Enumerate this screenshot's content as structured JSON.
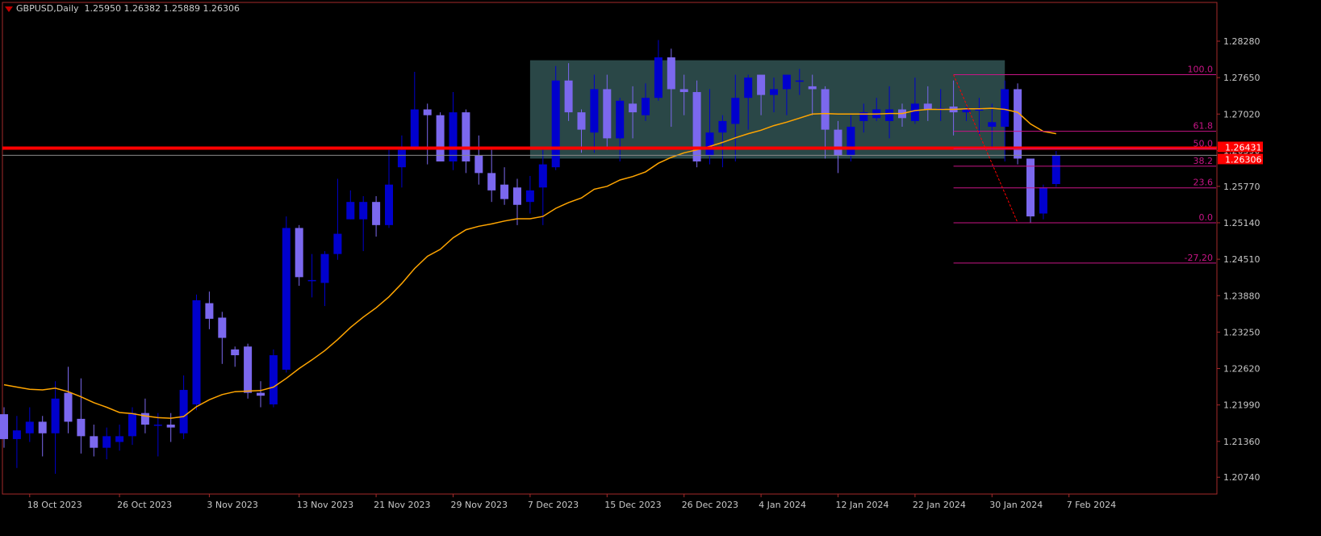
{
  "header": {
    "symbol": "GBPUSD,Daily",
    "ohlc": "1.25950 1.26382 1.25889 1.26306"
  },
  "colors": {
    "background": "#000000",
    "axis": "#a52a2a",
    "axis_text": "#c8c8c8",
    "bull": "#0000cd",
    "bear": "#7b68ee",
    "ma": "#ffa500",
    "resistance": "#ff0000",
    "rectangle": "#2f4f4f",
    "fibo": "#c71585"
  },
  "chart_data": {
    "type": "candlestick",
    "y_range": [
      1.2045,
      1.2895
    ],
    "y_ticks": [
      "1.28280",
      "1.27650",
      "1.27020",
      "1.26390",
      "1.25770",
      "1.25140",
      "1.24510",
      "1.23880",
      "1.23250",
      "1.22620",
      "1.21990",
      "1.21360",
      "1.20740"
    ],
    "x_labels": [
      {
        "i": 2,
        "text": "18 Oct 2023"
      },
      {
        "i": 9,
        "text": "26 Oct 2023"
      },
      {
        "i": 16,
        "text": "3 Nov 2023"
      },
      {
        "i": 23,
        "text": "13 Nov 2023"
      },
      {
        "i": 29,
        "text": "21 Nov 2023"
      },
      {
        "i": 35,
        "text": "29 Nov 2023"
      },
      {
        "i": 41,
        "text": "7 Dec 2023"
      },
      {
        "i": 47,
        "text": "15 Dec 2023"
      },
      {
        "i": 53,
        "text": "26 Dec 2023"
      },
      {
        "i": 59,
        "text": "4 Jan 2024"
      },
      {
        "i": 65,
        "text": "12 Jan 2024"
      },
      {
        "i": 71,
        "text": "22 Jan 2024"
      },
      {
        "i": 77,
        "text": "30 Jan 2024"
      },
      {
        "i": 83,
        "text": "7 Feb 2024"
      }
    ],
    "candles": [
      [
        1.2183,
        1.214,
        1.2195,
        1.2125
      ],
      [
        1.214,
        1.2155,
        1.218,
        1.209
      ],
      [
        1.215,
        1.217,
        1.2195,
        1.2135
      ],
      [
        1.217,
        1.215,
        1.218,
        1.211
      ],
      [
        1.215,
        1.221,
        1.224,
        1.208
      ],
      [
        1.222,
        1.217,
        1.2265,
        1.215
      ],
      [
        1.2175,
        1.2145,
        1.2245,
        1.2115
      ],
      [
        1.2145,
        1.2125,
        1.2165,
        1.211
      ],
      [
        1.2125,
        1.2145,
        1.216,
        1.2105
      ],
      [
        1.2135,
        1.2145,
        1.2165,
        1.212
      ],
      [
        1.2145,
        1.2185,
        1.2195,
        1.213
      ],
      [
        1.2185,
        1.2165,
        1.221,
        1.215
      ],
      [
        1.2165,
        1.2165,
        1.2185,
        1.211
      ],
      [
        1.2165,
        1.216,
        1.2185,
        1.2135
      ],
      [
        1.215,
        1.2225,
        1.225,
        1.214
      ],
      [
        1.22,
        1.238,
        1.239,
        1.219
      ],
      [
        1.2375,
        1.2348,
        1.2395,
        1.233
      ],
      [
        1.235,
        1.2315,
        1.236,
        1.227
      ],
      [
        1.2295,
        1.2285,
        1.23,
        1.2265
      ],
      [
        1.23,
        1.222,
        1.2305,
        1.221
      ],
      [
        1.222,
        1.2215,
        1.224,
        1.2195
      ],
      [
        1.22,
        1.2285,
        1.2295,
        1.2195
      ],
      [
        1.226,
        1.2505,
        1.2525,
        1.2255
      ],
      [
        1.2505,
        1.242,
        1.251,
        1.2405
      ],
      [
        1.2415,
        1.2415,
        1.246,
        1.2385
      ],
      [
        1.241,
        1.246,
        1.2465,
        1.237
      ],
      [
        1.246,
        1.2495,
        1.259,
        1.245
      ],
      [
        1.252,
        1.255,
        1.257,
        1.252
      ],
      [
        1.252,
        1.255,
        1.256,
        1.2465
      ],
      [
        1.255,
        1.251,
        1.256,
        1.249
      ],
      [
        1.251,
        1.258,
        1.264,
        1.2505
      ],
      [
        1.261,
        1.264,
        1.2665,
        1.2575
      ],
      [
        1.2645,
        1.271,
        1.2775,
        1.264
      ],
      [
        1.271,
        1.27,
        1.272,
        1.2615
      ],
      [
        1.27,
        1.262,
        1.2705,
        1.262
      ],
      [
        1.262,
        1.2705,
        1.274,
        1.2605
      ],
      [
        1.2705,
        1.262,
        1.271,
        1.26
      ],
      [
        1.263,
        1.26,
        1.2665,
        1.258
      ],
      [
        1.26,
        1.257,
        1.264,
        1.255
      ],
      [
        1.258,
        1.2555,
        1.261,
        1.2545
      ],
      [
        1.2575,
        1.2545,
        1.259,
        1.251
      ],
      [
        1.255,
        1.257,
        1.2595,
        1.253
      ],
      [
        1.2575,
        1.2615,
        1.264,
        1.251
      ],
      [
        1.261,
        1.276,
        1.2785,
        1.2605
      ],
      [
        1.276,
        1.2705,
        1.279,
        1.269
      ],
      [
        1.2705,
        1.2675,
        1.271,
        1.2635
      ],
      [
        1.267,
        1.2745,
        1.277,
        1.2635
      ],
      [
        1.2745,
        1.266,
        1.277,
        1.264
      ],
      [
        1.266,
        1.2725,
        1.273,
        1.262
      ],
      [
        1.272,
        1.2705,
        1.275,
        1.266
      ],
      [
        1.27,
        1.273,
        1.2755,
        1.269
      ],
      [
        1.273,
        1.28,
        1.283,
        1.2725
      ],
      [
        1.28,
        1.2745,
        1.2815,
        1.268
      ],
      [
        1.2745,
        1.274,
        1.277,
        1.27
      ],
      [
        1.274,
        1.262,
        1.276,
        1.261
      ],
      [
        1.263,
        1.267,
        1.2745,
        1.2615
      ],
      [
        1.267,
        1.269,
        1.27,
        1.261
      ],
      [
        1.2685,
        1.273,
        1.277,
        1.262
      ],
      [
        1.273,
        1.2765,
        1.277,
        1.2675
      ],
      [
        1.277,
        1.2735,
        1.277,
        1.27
      ],
      [
        1.2735,
        1.2745,
        1.2765,
        1.2705
      ],
      [
        1.2745,
        1.277,
        1.277,
        1.27
      ],
      [
        1.276,
        1.276,
        1.278,
        1.2735
      ],
      [
        1.275,
        1.2745,
        1.277,
        1.27
      ],
      [
        1.2745,
        1.2675,
        1.275,
        1.2625
      ],
      [
        1.2675,
        1.263,
        1.269,
        1.26
      ],
      [
        1.263,
        1.268,
        1.27,
        1.262
      ],
      [
        1.269,
        1.2705,
        1.272,
        1.267
      ],
      [
        1.2695,
        1.271,
        1.273,
        1.269
      ],
      [
        1.269,
        1.271,
        1.275,
        1.266
      ],
      [
        1.271,
        1.2695,
        1.272,
        1.268
      ],
      [
        1.269,
        1.272,
        1.2765,
        1.2685
      ],
      [
        1.272,
        1.271,
        1.275,
        1.269
      ],
      [
        1.271,
        1.2712,
        1.2745,
        1.269
      ],
      [
        1.2715,
        1.2705,
        1.276,
        1.2665
      ],
      [
        1.2705,
        1.271,
        1.2715,
        1.269
      ],
      [
        1.271,
        1.271,
        1.273,
        1.2665
      ],
      [
        1.268,
        1.2688,
        1.272,
        1.2645
      ],
      [
        1.268,
        1.2745,
        1.276,
        1.262
      ],
      [
        1.2745,
        1.2625,
        1.2755,
        1.2615
      ],
      [
        1.2625,
        1.2525,
        1.2625,
        1.2514
      ],
      [
        1.253,
        1.2575,
        1.258,
        1.252
      ],
      [
        1.2581,
        1.2631,
        1.2638,
        1.2576
      ]
    ],
    "ma_period": 20,
    "ma_values": [
      1.2234,
      1.223,
      1.2226,
      1.2225,
      1.2228,
      1.2222,
      1.2213,
      1.2203,
      1.2195,
      1.2186,
      1.2184,
      1.218,
      1.2177,
      1.2176,
      1.2179,
      1.2196,
      1.2208,
      1.2217,
      1.2222,
      1.2223,
      1.2224,
      1.223,
      1.2245,
      1.2262,
      1.2277,
      1.2293,
      1.2312,
      1.2333,
      1.2351,
      1.2367,
      1.2386,
      1.2409,
      1.2435,
      1.2456,
      1.2468,
      1.2488,
      1.2502,
      1.2508,
      1.2512,
      1.2517,
      1.2521,
      1.2521,
      1.2525,
      1.2539,
      1.2549,
      1.2557,
      1.2572,
      1.2577,
      1.2588,
      1.2594,
      1.2602,
      1.2617,
      1.2627,
      1.2635,
      1.264,
      1.2646,
      1.2653,
      1.2661,
      1.2668,
      1.2674,
      1.2682,
      1.2688,
      1.2695,
      1.2702,
      1.2703,
      1.2702,
      1.2702,
      1.2702,
      1.2702,
      1.2703,
      1.2703,
      1.2708,
      1.271,
      1.271,
      1.271,
      1.2711,
      1.2711,
      1.2712,
      1.271,
      1.2705,
      1.2685,
      1.2672,
      1.2668
    ],
    "resistance_level": 1.26431,
    "resistance_label": "1.26431",
    "bid_level": 1.26306,
    "bid_label": "1.26306",
    "rectangle": {
      "from_i": 41,
      "to_i": 78,
      "top": 1.2795,
      "bottom": 1.2625
    },
    "fibo": {
      "from_i": 74,
      "to_i": 96,
      "trend_from_i": 74,
      "trend_to_i": 79,
      "high": 1.277,
      "low": 1.2514,
      "levels": [
        {
          "ratio": 1.0,
          "label": "100.0"
        },
        {
          "ratio": 0.618,
          "label": "61.8"
        },
        {
          "ratio": 0.5,
          "label": "50.0"
        },
        {
          "ratio": 0.382,
          "label": "38.2"
        },
        {
          "ratio": 0.236,
          "label": "23.6"
        },
        {
          "ratio": 0.0,
          "label": "0.0"
        },
        {
          "ratio": -0.272,
          "label": "-27,20"
        }
      ]
    }
  }
}
